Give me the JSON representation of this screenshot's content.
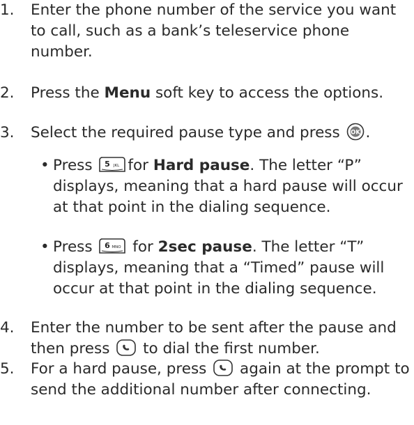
{
  "steps": [
    {
      "num": "1.",
      "text": "Enter the phone number of the service you want to call, such as a bank’s teleservice phone number."
    },
    {
      "num": "2.",
      "pre": "Press the ",
      "bold": "Menu",
      "post": " soft key to access the options."
    },
    {
      "num": "3.",
      "pre": "Select the required pause type and press ",
      "post": "."
    },
    {
      "num": "4.",
      "pre": "Enter the number to be sent after the pause and then press ",
      "post": " to dial the first number."
    },
    {
      "num": "5.",
      "pre": "For a hard pause, press ",
      "post": " again at the prompt to send the additional number after connecting."
    }
  ],
  "bullets": [
    {
      "dot": "•",
      "pre": "Press ",
      "mid": "for ",
      "bold": "Hard pause",
      "post": ". The letter “P” displays, meaning that a hard pause will occur at that point in the dialing sequence."
    },
    {
      "dot": "•",
      "pre": "Press ",
      "mid": " for ",
      "bold": "2sec pause",
      "post": ". The letter “T” displays, meaning that a “Timed” pause will occur at that point in the dialing sequence."
    }
  ],
  "keys": {
    "ok": {
      "label": "OK",
      "icon": "ok-key-icon"
    },
    "five": {
      "digit": "5",
      "letters": "JKL",
      "icon": "key-5-icon"
    },
    "six": {
      "digit": "6",
      "letters": "MNO",
      "icon": "key-6-icon"
    },
    "send": {
      "icon": "send-key-icon"
    }
  }
}
